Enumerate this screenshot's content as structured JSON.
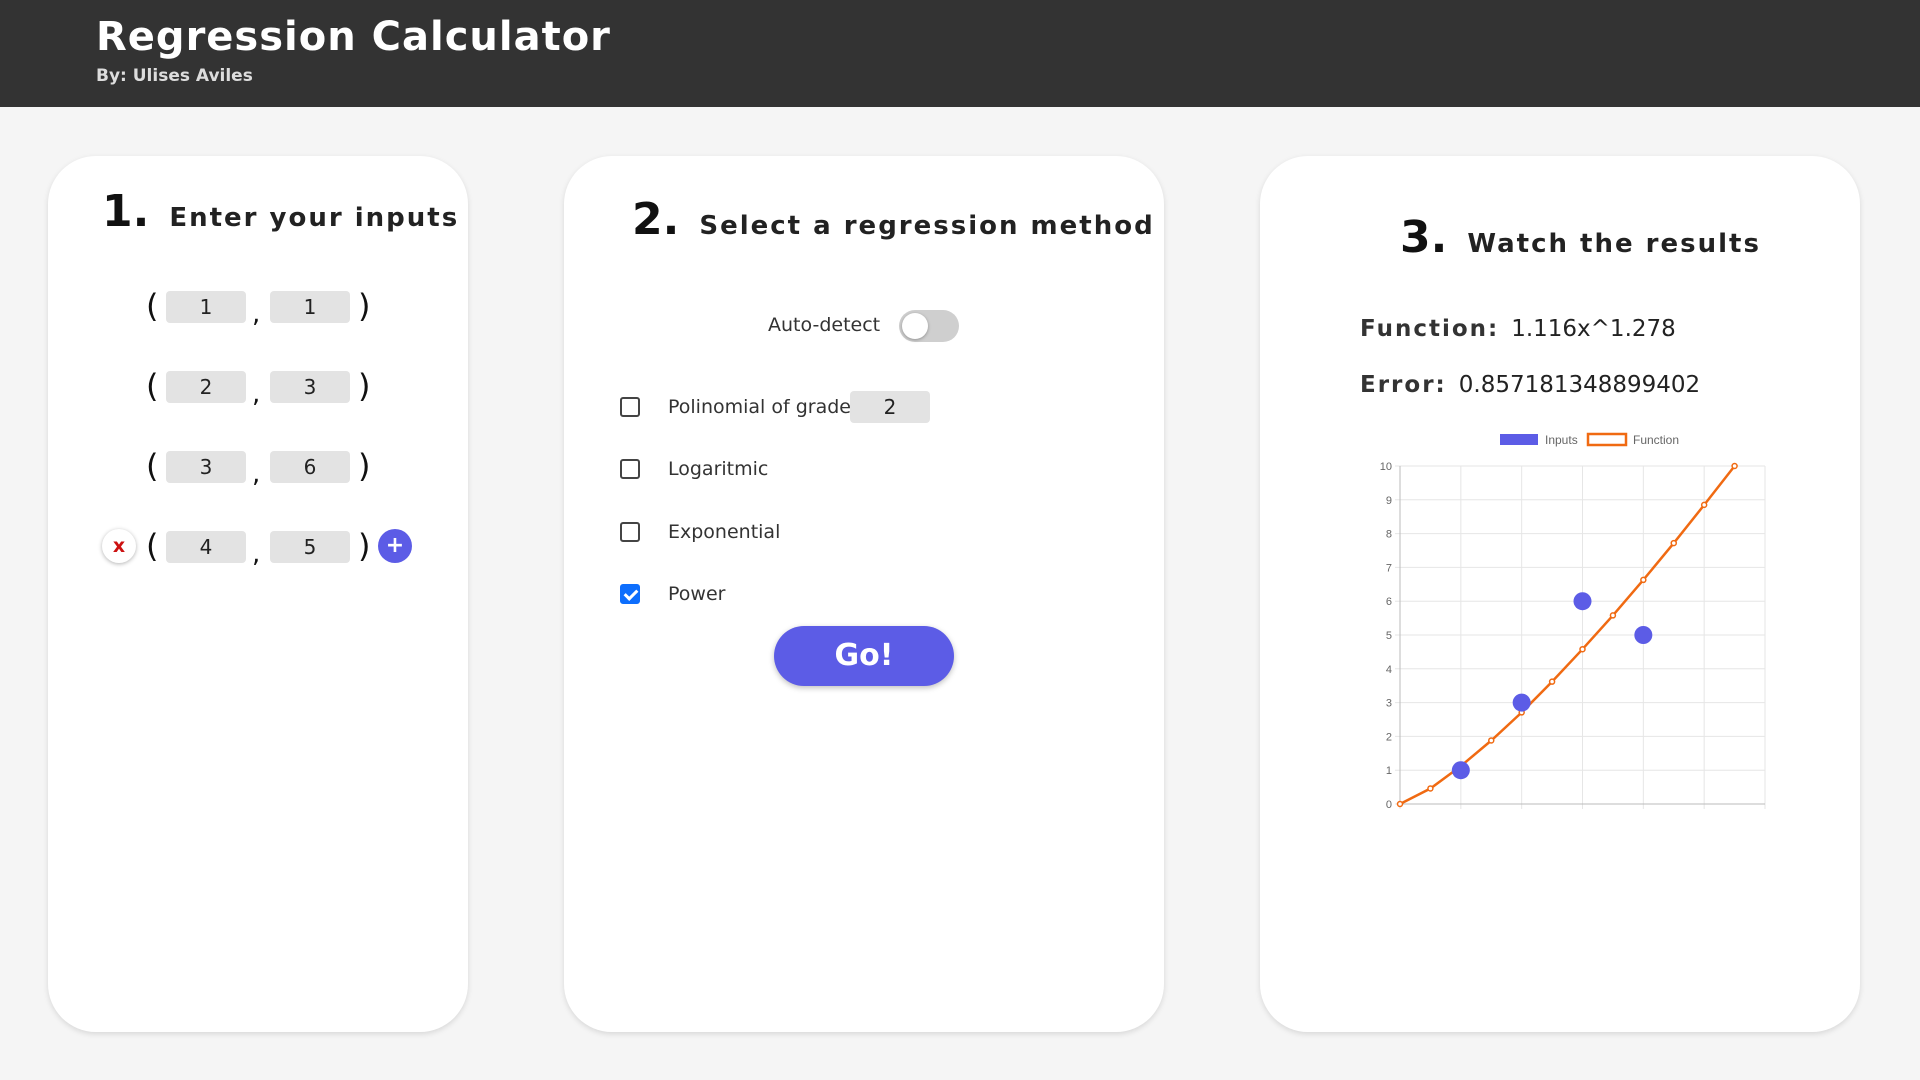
{
  "header": {
    "title": "Regression Calculator",
    "author": "By: Ulises Aviles"
  },
  "inputs": {
    "step_number": "1.",
    "step_title": "Enter your inputs",
    "pairs": [
      {
        "x": "1",
        "y": "1"
      },
      {
        "x": "2",
        "y": "3"
      },
      {
        "x": "3",
        "y": "6"
      },
      {
        "x": "4",
        "y": "5"
      }
    ],
    "open_paren": "(",
    "close_paren": ")",
    "comma": ",",
    "remove_label": "x",
    "add_label": "+"
  },
  "methods": {
    "step_number": "2.",
    "step_title": "Select a regression method",
    "auto_detect_label": "Auto-detect",
    "auto_detect_on": false,
    "polynomial_label": "Polinomial of grade:",
    "polynomial_grade": "2",
    "polynomial_checked": false,
    "logarithmic_label": "Logaritmic",
    "logarithmic_checked": false,
    "exponential_label": "Exponential",
    "exponential_checked": false,
    "power_label": "Power",
    "power_checked": true,
    "go_label": "Go!"
  },
  "results": {
    "step_number": "3.",
    "step_title": "Watch the results",
    "function_label": "Function:",
    "function_value": "1.116x^1.278",
    "error_label": "Error:",
    "error_value": "0.857181348899402"
  },
  "colors": {
    "accent": "#5c5ce6",
    "function_line": "#f06a12",
    "header_bg": "#333333",
    "checkbox_checked": "#0d6efd"
  },
  "chart_data": {
    "type": "scatter",
    "title": "",
    "xlabel": "",
    "ylabel": "",
    "xlim": [
      0,
      6
    ],
    "ylim": [
      0,
      10
    ],
    "x_ticks": [
      "0",
      "1",
      "2",
      "3",
      "4",
      "5",
      "6"
    ],
    "y_ticks": [
      "0",
      "1",
      "2",
      "3",
      "4",
      "5",
      "6",
      "7",
      "8",
      "9",
      "10"
    ],
    "grid": true,
    "legend_position": "top",
    "series": [
      {
        "name": "Inputs",
        "type": "scatter",
        "color": "#5c5ce6",
        "points": [
          [
            1,
            1
          ],
          [
            2,
            3
          ],
          [
            3,
            6
          ],
          [
            4,
            5
          ]
        ]
      },
      {
        "name": "Function",
        "type": "line",
        "color": "#f06a12",
        "points": [
          [
            0,
            0
          ],
          [
            0.5,
            0.46
          ],
          [
            1,
            1.12
          ],
          [
            1.5,
            1.88
          ],
          [
            2,
            2.71
          ],
          [
            2.5,
            3.62
          ],
          [
            3,
            4.58
          ],
          [
            3.5,
            5.58
          ],
          [
            4,
            6.63
          ],
          [
            4.5,
            7.72
          ],
          [
            5,
            8.85
          ],
          [
            5.5,
            10.0
          ]
        ]
      }
    ]
  }
}
